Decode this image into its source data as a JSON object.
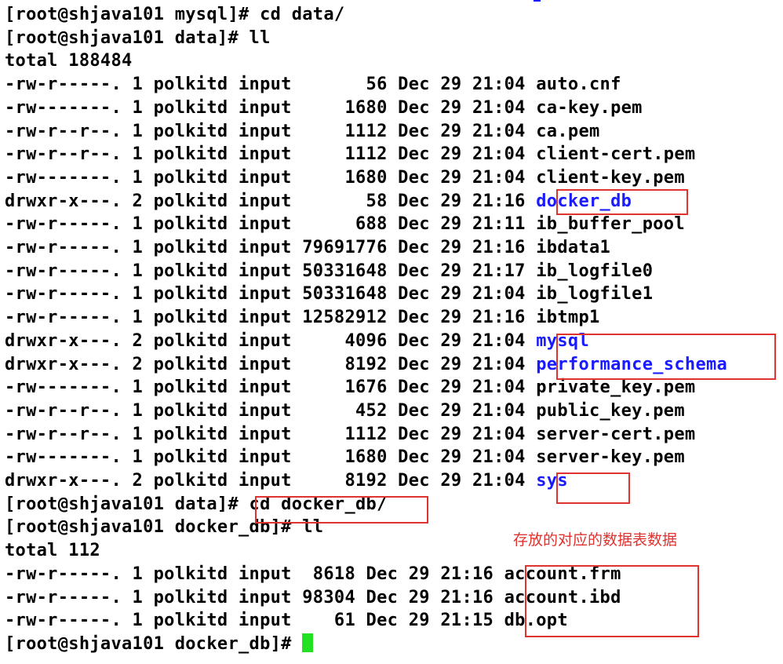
{
  "terminal": {
    "lines": [
      {
        "text": "[root@shjava101 mysql]# cd data/"
      },
      {
        "text": "[root@shjava101 data]# ll"
      },
      {
        "text": "total 188484"
      },
      {
        "text": "-rw-r-----. 1 polkitd input       56 Dec 29 21:04 ",
        "name": "auto.cnf"
      },
      {
        "text": "-rw-------. 1 polkitd input     1680 Dec 29 21:04 ",
        "name": "ca-key.pem"
      },
      {
        "text": "-rw-r--r--. 1 polkitd input     1112 Dec 29 21:04 ",
        "name": "ca.pem"
      },
      {
        "text": "-rw-r--r--. 1 polkitd input     1112 Dec 29 21:04 ",
        "name": "client-cert.pem"
      },
      {
        "text": "-rw-------. 1 polkitd input     1680 Dec 29 21:04 ",
        "name": "client-key.pem"
      },
      {
        "text": "drwxr-x---. 2 polkitd input       58 Dec 29 21:16 ",
        "name": "docker_db",
        "dir": true
      },
      {
        "text": "-rw-r-----. 1 polkitd input      688 Dec 29 21:11 ",
        "name": "ib_buffer_pool"
      },
      {
        "text": "-rw-r-----. 1 polkitd input 79691776 Dec 29 21:16 ",
        "name": "ibdata1"
      },
      {
        "text": "-rw-r-----. 1 polkitd input 50331648 Dec 29 21:17 ",
        "name": "ib_logfile0"
      },
      {
        "text": "-rw-r-----. 1 polkitd input 50331648 Dec 29 21:04 ",
        "name": "ib_logfile1"
      },
      {
        "text": "-rw-r-----. 1 polkitd input 12582912 Dec 29 21:16 ",
        "name": "ibtmp1"
      },
      {
        "text": "drwxr-x---. 2 polkitd input     4096 Dec 29 21:04 ",
        "name": "mysql",
        "dir": true
      },
      {
        "text": "drwxr-x---. 2 polkitd input     8192 Dec 29 21:04 ",
        "name": "performance_schema",
        "dir": true
      },
      {
        "text": "-rw-------. 1 polkitd input     1676 Dec 29 21:04 ",
        "name": "private_key.pem"
      },
      {
        "text": "-rw-r--r--. 1 polkitd input      452 Dec 29 21:04 ",
        "name": "public_key.pem"
      },
      {
        "text": "-rw-r--r--. 1 polkitd input     1112 Dec 29 21:04 ",
        "name": "server-cert.pem"
      },
      {
        "text": "-rw-------. 1 polkitd input     1680 Dec 29 21:04 ",
        "name": "server-key.pem"
      },
      {
        "text": "drwxr-x---. 2 polkitd input     8192 Dec 29 21:04 ",
        "name": "sys",
        "dir": true
      },
      {
        "text": "[root@shjava101 data]# cd docker_db/"
      },
      {
        "text": "[root@shjava101 docker_db]# ll"
      },
      {
        "text": "total 112"
      },
      {
        "text": "-rw-r-----. 1 polkitd input  8618 Dec 29 21:16 ",
        "name": "account.frm"
      },
      {
        "text": "-rw-r-----. 1 polkitd input 98304 Dec 29 21:16 ",
        "name": "account.ibd"
      },
      {
        "text": "-rw-r-----. 1 polkitd input    61 Dec 29 21:15 ",
        "name": "db.opt"
      },
      {
        "text": "[root@shjava101 docker_db]# ",
        "cursor": true
      }
    ]
  },
  "annotation": {
    "note": "存放的对应的数据表数据",
    "highlight_color": "#e0332f",
    "directory_color": "#1a1aff",
    "cursor_color": "#22e022"
  }
}
